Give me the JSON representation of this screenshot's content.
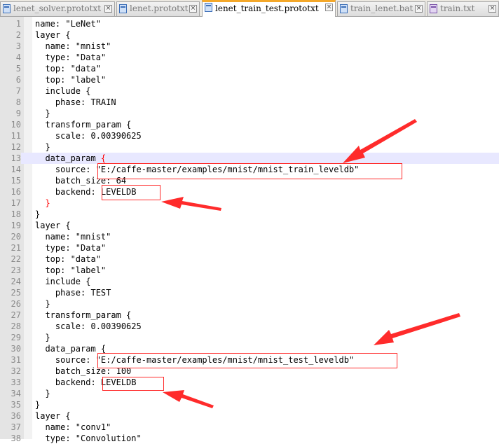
{
  "tabs": [
    {
      "label": "lenet_solver.prototxt",
      "active": false,
      "icon": "file-icon"
    },
    {
      "label": "lenet.prototxt",
      "active": false,
      "icon": "file-icon"
    },
    {
      "label": "lenet_train_test.prototxt",
      "active": true,
      "icon": "file-icon"
    },
    {
      "label": "train_lenet.bat",
      "active": false,
      "icon": "file-icon"
    },
    {
      "label": "train.txt",
      "active": false,
      "icon": "file-icon-purple"
    }
  ],
  "close_glyph": "×",
  "editor": {
    "current_line": 13,
    "lines": [
      {
        "n": "1",
        "text": "name: \"LeNet\""
      },
      {
        "n": "2",
        "text": "layer {"
      },
      {
        "n": "3",
        "text": "  name: \"mnist\""
      },
      {
        "n": "4",
        "text": "  type: \"Data\""
      },
      {
        "n": "5",
        "text": "  top: \"data\""
      },
      {
        "n": "6",
        "text": "  top: \"label\""
      },
      {
        "n": "7",
        "text": "  include {"
      },
      {
        "n": "8",
        "text": "    phase: TRAIN"
      },
      {
        "n": "9",
        "text": "  }"
      },
      {
        "n": "10",
        "text": "  transform_param {"
      },
      {
        "n": "11",
        "text": "    scale: 0.00390625"
      },
      {
        "n": "12",
        "text": "  }"
      },
      {
        "n": "13",
        "text": "  data_param ",
        "hl": "{"
      },
      {
        "n": "14",
        "text": "    source: \"E:/caffe-master/examples/mnist/mnist_train_leveldb\""
      },
      {
        "n": "15",
        "text": "    batch_size: 64"
      },
      {
        "n": "16",
        "text": "    backend: LEVELDB"
      },
      {
        "n": "17",
        "text": "  ",
        "hl": "}"
      },
      {
        "n": "18",
        "text": "}"
      },
      {
        "n": "19",
        "text": "layer {"
      },
      {
        "n": "20",
        "text": "  name: \"mnist\""
      },
      {
        "n": "21",
        "text": "  type: \"Data\""
      },
      {
        "n": "22",
        "text": "  top: \"data\""
      },
      {
        "n": "23",
        "text": "  top: \"label\""
      },
      {
        "n": "24",
        "text": "  include {"
      },
      {
        "n": "25",
        "text": "    phase: TEST"
      },
      {
        "n": "26",
        "text": "  }"
      },
      {
        "n": "27",
        "text": "  transform_param {"
      },
      {
        "n": "28",
        "text": "    scale: 0.00390625"
      },
      {
        "n": "29",
        "text": "  }"
      },
      {
        "n": "30",
        "text": "  data_param {"
      },
      {
        "n": "31",
        "text": "    source: \"E:/caffe-master/examples/mnist/mnist_test_leveldb\""
      },
      {
        "n": "32",
        "text": "    batch_size: 100"
      },
      {
        "n": "33",
        "text": "    backend: LEVELDB"
      },
      {
        "n": "34",
        "text": "  }"
      },
      {
        "n": "35",
        "text": "}"
      },
      {
        "n": "36",
        "text": "layer {"
      },
      {
        "n": "37",
        "text": "  name: \"conv1\""
      },
      {
        "n": "38",
        "text": "  type: \"Convolution\""
      }
    ]
  },
  "annotation_color": "#ff2b2b"
}
